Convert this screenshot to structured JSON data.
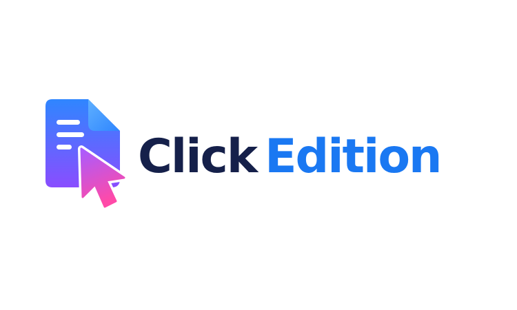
{
  "logo": {
    "word_dark": "Click",
    "word_blue": "Edition",
    "icon": "document-cursor-icon",
    "colors": {
      "dark": "#15204a",
      "blue": "#1a78f2",
      "gradient_top": "#3b7bff",
      "gradient_bottom": "#8a4dff",
      "cursor_top": "#a65bff",
      "cursor_bottom": "#ff4aa6"
    }
  }
}
